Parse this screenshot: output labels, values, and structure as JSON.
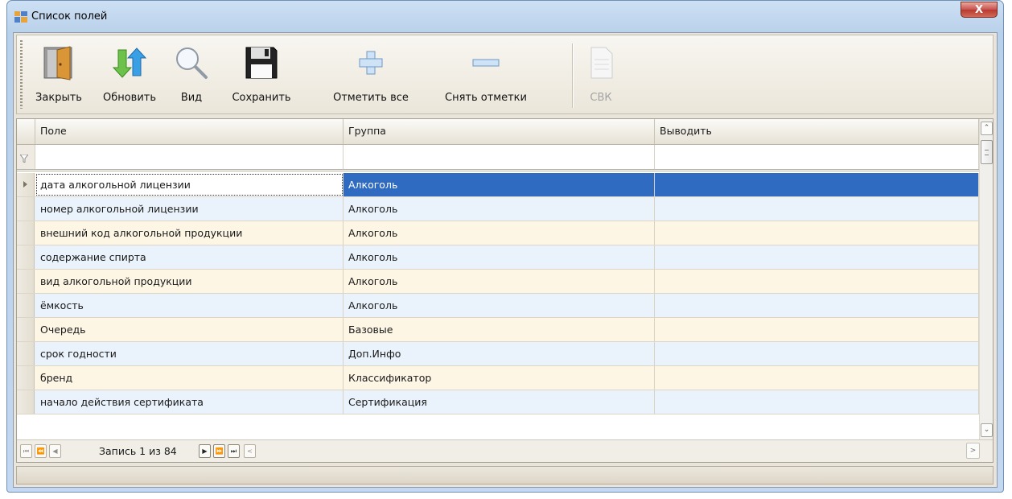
{
  "window": {
    "title": "Список полей",
    "close_label": "X"
  },
  "toolbar": {
    "buttons": [
      {
        "id": "close",
        "label": "Закрыть",
        "icon": "door-exit-icon",
        "enabled": true
      },
      {
        "id": "refresh",
        "label": "Обновить",
        "icon": "refresh-arrows-icon",
        "enabled": true
      },
      {
        "id": "view",
        "label": "Вид",
        "icon": "magnifier-icon",
        "enabled": true
      },
      {
        "id": "save",
        "label": "Сохранить",
        "icon": "floppy-disk-icon",
        "enabled": true
      },
      {
        "id": "check_all",
        "label": "Отметить все",
        "icon": "plus-icon",
        "enabled": true
      },
      {
        "id": "uncheck",
        "label": "Снять отметки",
        "icon": "minus-icon",
        "enabled": true
      },
      {
        "id": "cbk",
        "label": "СВК",
        "icon": "document-icon",
        "enabled": false
      }
    ]
  },
  "grid": {
    "columns": [
      "Поле",
      "Группа",
      "Выводить"
    ],
    "rows": [
      {
        "field": "дата алкогольной лицензии",
        "group": "Алкоголь",
        "output": ""
      },
      {
        "field": "номер алкогольной лицензии",
        "group": "Алкоголь",
        "output": ""
      },
      {
        "field": "внешний код алкогольной продукции",
        "group": "Алкоголь",
        "output": ""
      },
      {
        "field": "содержание спирта",
        "group": "Алкоголь",
        "output": ""
      },
      {
        "field": "вид алкогольной продукции",
        "group": "Алкоголь",
        "output": ""
      },
      {
        "field": "ёмкость",
        "group": "Алкоголь",
        "output": ""
      },
      {
        "field": "Очередь",
        "group": "Базовые",
        "output": ""
      },
      {
        "field": "срок годности",
        "group": "Доп.Инфо",
        "output": ""
      },
      {
        "field": "бренд",
        "group": "Классификатор",
        "output": ""
      },
      {
        "field": "начало действия сертификата",
        "group": "Сертификация",
        "output": ""
      }
    ],
    "selected_row": 0
  },
  "navigator": {
    "record_text": "Запись 1 из 84"
  },
  "colors": {
    "selection": "#2e6bc1",
    "row_odd": "#fdf6e5",
    "row_even": "#eaf2fb"
  }
}
